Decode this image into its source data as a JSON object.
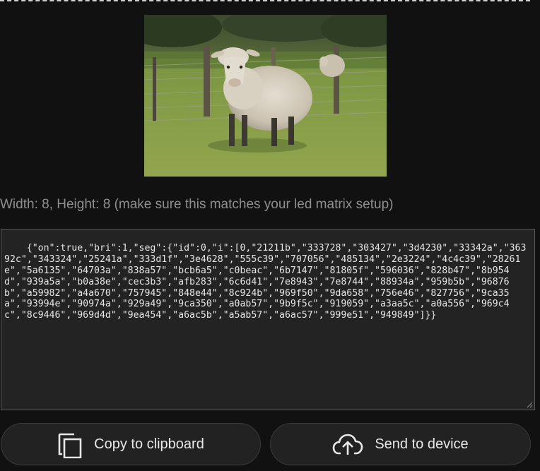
{
  "top_border": {},
  "preview": {
    "image_name": "sheep-in-pasture-photo"
  },
  "info": {
    "text": "Width: 8, Height: 8 (make sure this matches your led matrix setup)"
  },
  "output": {
    "json_text": "{\"on\":true,\"bri\":1,\"seg\":{\"id\":0,\"i\":[0,\"21211b\",\"333728\",\"303427\",\"3d4230\",\"33342a\",\"36392c\",\"343324\",\"25241a\",\"333d1f\",\"3e4628\",\"555c39\",\"707056\",\"485134\",\"2e3224\",\"4c4c39\",\"28261e\",\"5a6135\",\"64703a\",\"838a57\",\"bcb6a5\",\"c0beac\",\"6b7147\",\"81805f\",\"596036\",\"828b47\",\"8b954d\",\"939a5a\",\"b0a38e\",\"cec3b3\",\"afb283\",\"6c6d41\",\"7e8943\",\"7e8744\",\"88934a\",\"959b5b\",\"96876b\",\"a59982\",\"a4a670\",\"757945\",\"848e44\",\"8c924b\",\"969f50\",\"9da658\",\"756e46\",\"827756\",\"9ca35a\",\"93994e\",\"90974a\",\"929a49\",\"9ca350\",\"a0ab57\",\"9b9f5c\",\"919059\",\"a3aa5c\",\"a0a556\",\"969c4c\",\"8c9446\",\"969d4d\",\"9ea454\",\"a6ac5b\",\"a5ab57\",\"a6ac57\",\"999e51\",\"949849\"]}}"
  },
  "buttons": {
    "copy_label": "Copy to clipboard",
    "send_label": "Send to device"
  },
  "icons": {
    "copy": "copy-icon",
    "send": "cloud-upload-icon"
  },
  "colors": {
    "background": "#111111",
    "button_bg": "#222222",
    "textarea_bg": "#232323",
    "muted_text": "#8f8f8f"
  }
}
